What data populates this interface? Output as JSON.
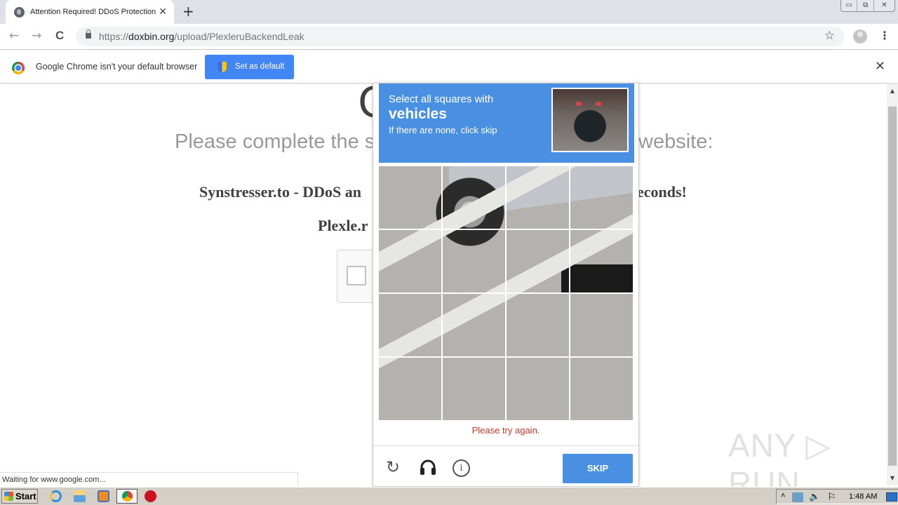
{
  "browser": {
    "tab": {
      "title": "Attention Required! DDoS Protection",
      "favicon": "globe-icon",
      "close": "✕"
    },
    "new_tab": "+",
    "window_controls": {
      "minimize": "▭",
      "restore": "⧉",
      "close": "✕"
    },
    "nav": {
      "back": "←",
      "forward": "→",
      "reload": "C"
    },
    "address": {
      "host_prefix": "https://",
      "host": "doxbin.org",
      "path": "/upload/PlexleruBackendLeak"
    },
    "bookmark_icon": "☆",
    "menu_icon": "⋮"
  },
  "infobar": {
    "message": "Google Chrome isn't your default browser",
    "button": "Set as default",
    "close": "✕"
  },
  "page": {
    "heading": "One",
    "subheading": "Please complete the security check to access the website:",
    "subheading_visible_left": "Please complete the s",
    "subheading_visible_right": "website:",
    "link1_left": "Synstresser.to - DDoS an",
    "link1_right": "econds!",
    "link2_left": "Plexle.r"
  },
  "captcha": {
    "instruction": "Select all squares with",
    "target": "vehicles",
    "hint": "If there are none, click skip",
    "error": "Please try again.",
    "reload_icon": "↻",
    "info_icon": "i",
    "skip": "SKIP",
    "grid_rows": 4,
    "grid_cols": 4
  },
  "status_bar": "Waiting for www.google.com...",
  "watermark": "ANY ▷ RUN",
  "taskbar": {
    "start": "Start",
    "clock": "1:48 AM",
    "tray": {
      "expand": "˄",
      "speaker": "🔈",
      "flag": "⚐"
    }
  },
  "scrollbar": {
    "up": "▲",
    "down": "▼"
  }
}
